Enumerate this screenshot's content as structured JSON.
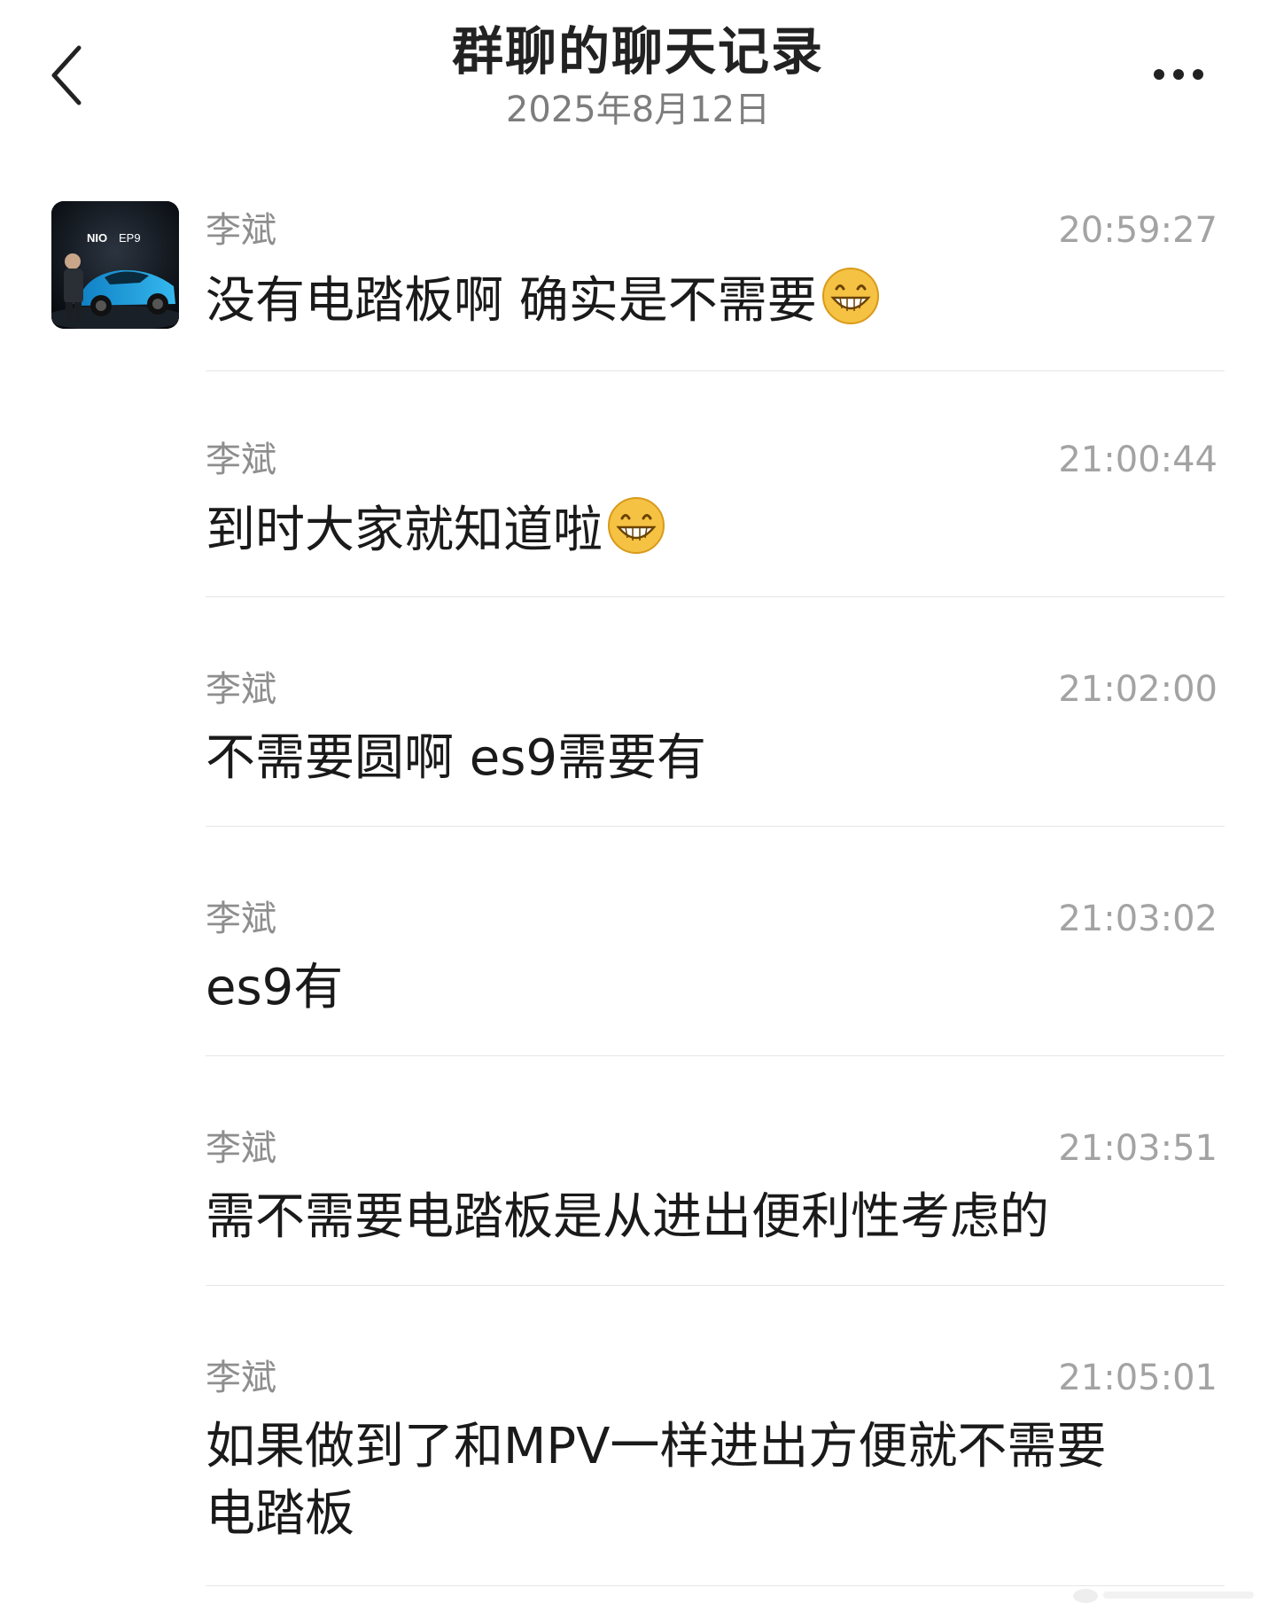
{
  "header": {
    "title": "群聊的聊天记录",
    "date": "2025年8月12日"
  },
  "avatar": {
    "brand_text": "NIO",
    "model_text": "EP9"
  },
  "messages": [
    {
      "sender": "李斌",
      "time": "20:59:27",
      "text": "没有电踏板啊 确实是不需要",
      "emoji": "grinning-face-emoji"
    },
    {
      "sender": "李斌",
      "time": "21:00:44",
      "text": "到时大家就知道啦",
      "emoji": "grinning-face-emoji"
    },
    {
      "sender": "李斌",
      "time": "21:02:00",
      "text": "不需要圆啊 es9需要有"
    },
    {
      "sender": "李斌",
      "time": "21:03:02",
      "text": "es9有"
    },
    {
      "sender": "李斌",
      "time": "21:03:51",
      "text": "需不需要电踏板是从进出便利性考虑的"
    },
    {
      "sender": "李斌",
      "time": "21:05:01",
      "text": "如果做到了和MPV一样进出方便就不需要\n电踏板"
    }
  ],
  "icons": {
    "back": "chevron-left-icon",
    "more": "more-dots-icon"
  },
  "colors": {
    "background": "#ffffff",
    "title": "#222222",
    "meta": "#8e8e8e",
    "divider": "#e6e6e6",
    "emoji": "#f5c243"
  }
}
